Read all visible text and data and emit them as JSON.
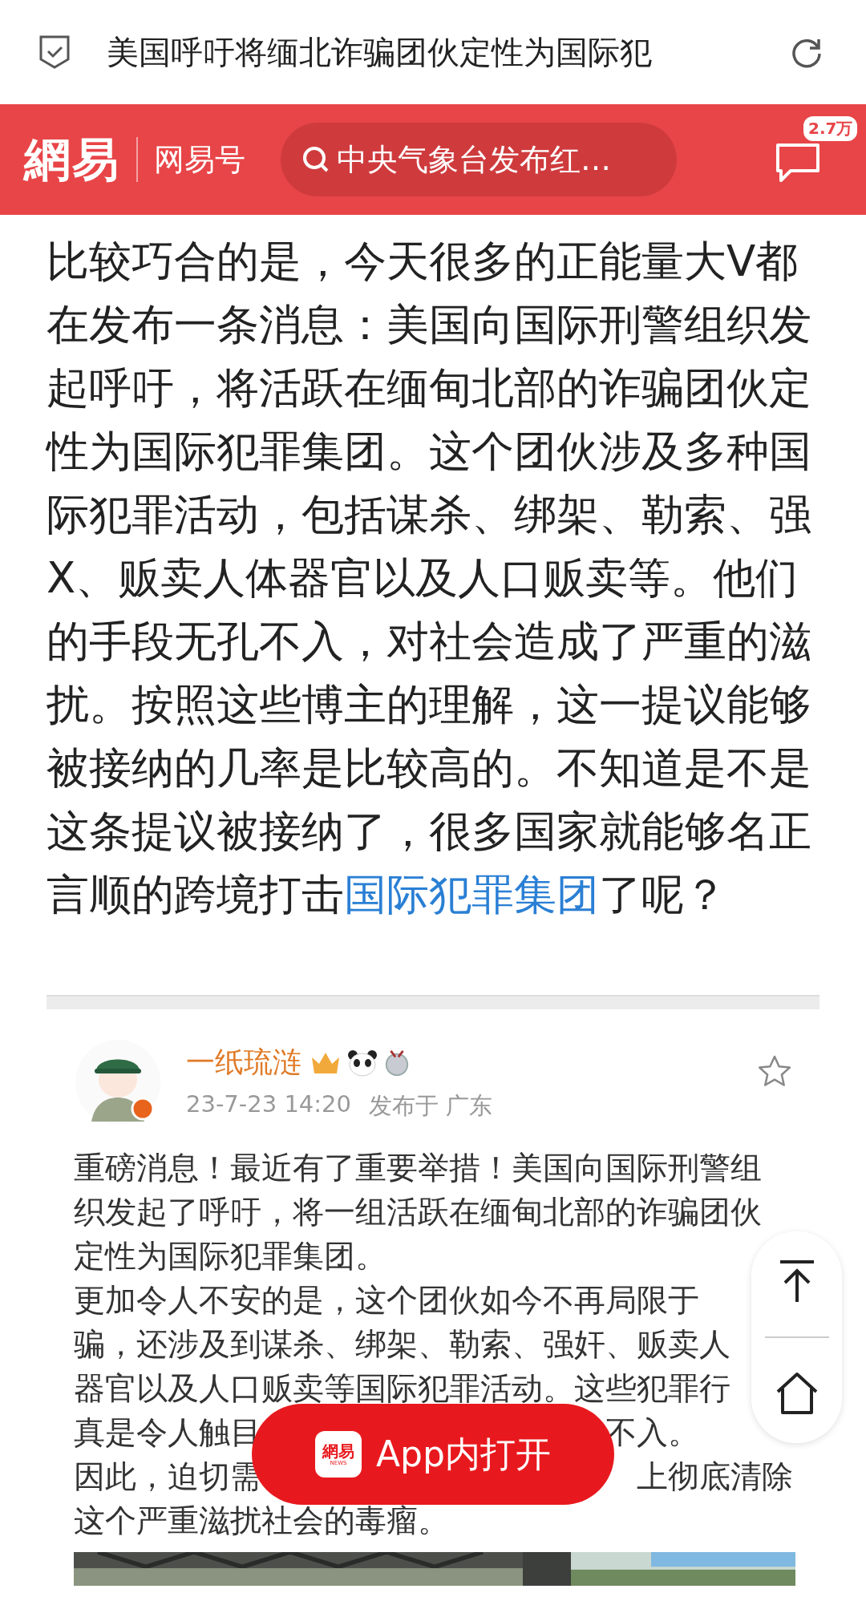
{
  "browser_bar": {
    "title": "美国呼吁将缅北诈骗团伙定性为国际犯"
  },
  "header": {
    "logo": "網易",
    "channel": "网易号",
    "search": {
      "value": "中央气象台发布红…"
    },
    "comment_badge": "2.7万"
  },
  "article": {
    "text": "比较巧合的是，今天很多的正能量大V都在发布一条消息：美国向国际刑警组织发起呼吁，将活跃在缅甸北部的诈骗团伙定性为国际犯罪集团。这个团伙涉及多种国际犯罪活动，包括谋杀、绑架、勒索、强X、贩卖人体器官以及人口贩卖等。他们的手段无孔不入，对社会造成了严重的滋扰。按照这些博主的理解，这一提议能够被接纳的几率是比较高的。不知道是不是这条提议被接纳了，很多国家就能够名正言顺的跨境打击",
    "link": "国际犯罪集团",
    "text_after": "了呢？"
  },
  "embedded_post": {
    "author": "一纸琉涟",
    "date": "23-7-23 14:20",
    "location": "发布于 广东",
    "starred": false,
    "lines": [
      {
        "left": "重磅消息！最近有了重要举措！美国向国际刑警组"
      },
      {
        "left": "织发起了呼吁，将一组活跃在缅甸北部的诈骗团伙"
      },
      {
        "left": "定性为国际犯罪集团。"
      },
      {
        "left": "更加令人不安的是，这个团伙如今不再局限于"
      },
      {
        "left": "骗，还涉及到谋杀、绑架、勒索、强奸、贩卖人"
      },
      {
        "left": "器官以及人口贩卖等国际犯罪活动。这些犯罪行"
      },
      {
        "left": "真是令人触目",
        "right": "不入。"
      },
      {
        "left": "因此，迫切需",
        "right": "上彻底清除"
      },
      {
        "left": "这个严重滋扰社会的毒瘤。"
      }
    ]
  },
  "open_app_button": {
    "label": "App内打开",
    "icon_text": "網易",
    "icon_subtext": "NEWS"
  }
}
